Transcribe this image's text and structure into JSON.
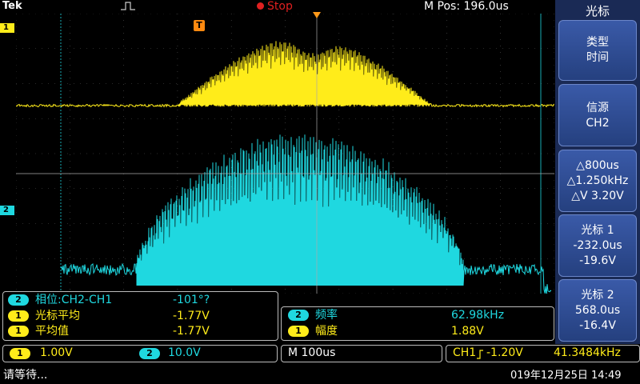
{
  "status": {
    "brand": "Tek",
    "run_state": "Stop",
    "m_pos_label": "M Pos: 196.0us",
    "trigger_marker": "T"
  },
  "menu": {
    "title": "光标",
    "buttons": [
      {
        "lines": [
          "类型",
          "时间"
        ]
      },
      {
        "lines": [
          "信源",
          "CH2"
        ]
      },
      {
        "lines": [
          "△800us",
          "△1.250kHz",
          "△V 3.20V"
        ]
      },
      {
        "lines": [
          "光标 1",
          "-232.0us",
          "-19.6V"
        ]
      },
      {
        "lines": [
          "光标 2",
          "568.0us",
          "-16.4V"
        ]
      }
    ]
  },
  "channels": {
    "ch1_marker": "1",
    "ch2_marker": "2",
    "ch1_color": "#ffec1a",
    "ch2_color": "#1fd8e0"
  },
  "measurements_left": [
    {
      "ch": "2",
      "label": "相位:CH2-CH1",
      "value": "-101°?"
    },
    {
      "ch": "1",
      "label": "光标平均",
      "value": "-1.77V"
    },
    {
      "ch": "1",
      "label": "平均值",
      "value": "-1.77V"
    }
  ],
  "measurements_right": [
    {
      "ch": "2",
      "label": "频率",
      "value": "62.98kHz"
    },
    {
      "ch": "1",
      "label": "幅度",
      "value": "1.88V"
    }
  ],
  "scale": {
    "ch1": "1.00V",
    "ch2": "10.0V",
    "horizontal": "M 100us",
    "trigger_source": "CH1",
    "trigger_level": "-1.20V",
    "trigger_freq": "41.3484kHz"
  },
  "footer": {
    "status_text": "请等待...",
    "datetime": "019年12月25日  14:49"
  }
}
